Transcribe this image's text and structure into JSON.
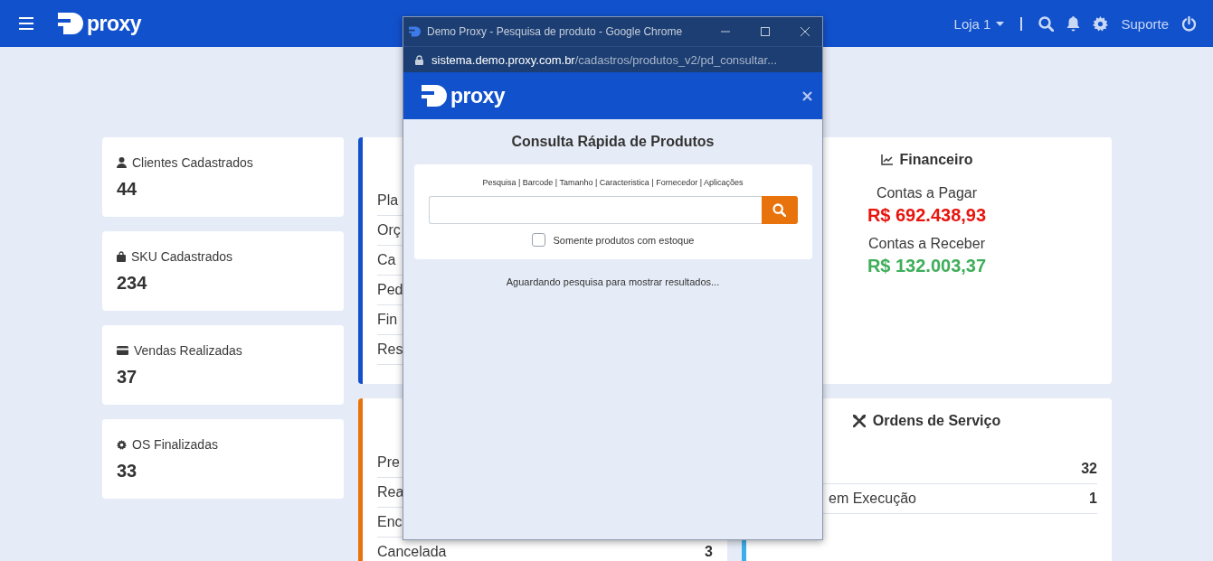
{
  "navbar": {
    "logo": "proxy",
    "store": "Loja 1",
    "support": "Suporte"
  },
  "stats": [
    {
      "label": "Clientes Cadastrados",
      "value": "44"
    },
    {
      "label": "SKU Cadastrados",
      "value": "234"
    },
    {
      "label": "Vendas Realizadas",
      "value": "37"
    },
    {
      "label": "OS Finalizadas",
      "value": "33"
    }
  ],
  "panels": [
    {
      "rows": [
        {
          "label": "Pla"
        },
        {
          "label": "Orç"
        },
        {
          "label": "Ca"
        },
        {
          "label": "Ped"
        },
        {
          "label": "Fin"
        },
        {
          "label": "Res"
        }
      ]
    },
    {
      "rows": [
        {
          "label": "Pre"
        },
        {
          "label": "Rea"
        },
        {
          "label": "Enc"
        },
        {
          "label": "Cancelada",
          "value": "3"
        }
      ]
    }
  ],
  "financeiro": {
    "title": "Financeiro",
    "items": [
      {
        "label": "Contas a Pagar",
        "amount": "R$ 692.438,93",
        "kind": "debit"
      },
      {
        "label": "Contas a Receber",
        "amount": "R$ 132.003,37",
        "kind": "credit"
      }
    ]
  },
  "ordens": {
    "title": "Ordens de Serviço",
    "rows": [
      {
        "value": "32"
      },
      {
        "label": "em Execução",
        "value": "1"
      }
    ]
  },
  "popup": {
    "window_title": "Demo Proxy - Pesquisa de produto - Google Chrome",
    "url_host": "sistema.demo.proxy.com.br",
    "url_path": "/cadastros/produtos_v2/pd_consultar...",
    "logo": "proxy",
    "heading": "Consulta Rápida de Produtos",
    "search_modes": "Pesquisa | Barcode | Tamanho | Caracteristica | Fornecedor | Aplicações",
    "stock_only": {
      "label": "Somente produtos com estoque",
      "checked": false
    },
    "status": "Aguardando pesquisa para mostrar resultados..."
  }
}
